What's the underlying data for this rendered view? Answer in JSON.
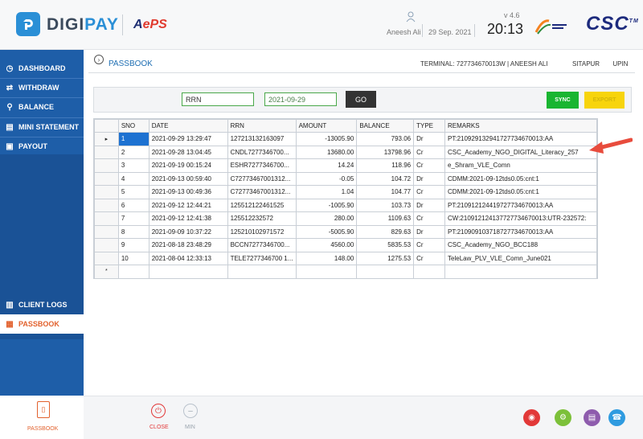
{
  "header": {
    "brand_left": "DIGI",
    "brand_right": "PAY",
    "aeps_a": "A",
    "aeps_e": "e",
    "aeps_ps": "PS",
    "user_name": "Aneesh Ali",
    "date": "29 Sep. 2021",
    "version": "v 4.6",
    "time": "20:13",
    "csc": "CSC",
    "tm": "TM"
  },
  "sidebar": {
    "items": [
      {
        "label": "DASHBOARD",
        "icon": "dashboard-icon"
      },
      {
        "label": "WITHDRAW",
        "icon": "withdraw-icon"
      },
      {
        "label": "BALANCE",
        "icon": "balance-icon"
      },
      {
        "label": "MINI STATEMENT",
        "icon": "statement-icon"
      },
      {
        "label": "PAYOUT",
        "icon": "payout-icon"
      },
      {
        "label": "CLIENT LOGS",
        "icon": "logs-icon"
      },
      {
        "label": "PASSBOOK",
        "icon": "passbook-icon"
      }
    ],
    "active": "PASSBOOK"
  },
  "main": {
    "title": "PASSBOOK",
    "terminal": "TERMINAL: 727734670013W | ANEESH ALI",
    "location": "SITAPUR",
    "state": "UPIN"
  },
  "filters": {
    "rrn_value": "RRN",
    "date_value": "2021-09-29",
    "go_label": "GO",
    "sync_label": "SYNC",
    "export_label": "EXPORT"
  },
  "table": {
    "columns": [
      "SNO",
      "DATE",
      "RRN",
      "AMOUNT",
      "BALANCE",
      "TYPE",
      "REMARKS"
    ],
    "rows": [
      [
        "1",
        "2021-09-29 13:29:47",
        "127213132163097",
        "-13005.90",
        "793.06",
        "Dr",
        "PT:210929132941727734670013:AA"
      ],
      [
        "2",
        "2021-09-28 13:04:45",
        "CNDL7277346700...",
        "13680.00",
        "13798.96",
        "Cr",
        "CSC_Academy_NGO_DIGITAL_Literacy_257"
      ],
      [
        "3",
        "2021-09-19 00:15:24",
        "ESHR7277346700...",
        "14.24",
        "118.96",
        "Cr",
        "e_Shram_VLE_Comn"
      ],
      [
        "4",
        "2021-09-13 00:59:40",
        "C72773467001312...",
        "-0.05",
        "104.72",
        "Dr",
        "CDMM:2021-09-12tds0.05:cnt:1"
      ],
      [
        "5",
        "2021-09-13 00:49:36",
        "C72773467001312...",
        "1.04",
        "104.77",
        "Cr",
        "CDMM:2021-09-12tds0.05:cnt:1"
      ],
      [
        "6",
        "2021-09-12 12:44:21",
        "125512122461525",
        "-1005.90",
        "103.73",
        "Dr",
        "PT:210912124419727734670013:AA"
      ],
      [
        "7",
        "2021-09-12 12:41:38",
        "125512232572",
        "280.00",
        "1109.63",
        "Cr",
        "CW:210912124137727734670013:UTR-232572:"
      ],
      [
        "8",
        "2021-09-09 10:37:22",
        "125210102971572",
        "-5005.90",
        "829.63",
        "Dr",
        "PT:210909103718727734670013:AA"
      ],
      [
        "9",
        "2021-08-18 23:48:29",
        "BCCN7277346700...",
        "4560.00",
        "5835.53",
        "Cr",
        "CSC_Academy_NGO_BCC188"
      ],
      [
        "10",
        "2021-08-04 12:33:13",
        "TELE7277346700 1...",
        "148.00",
        "1275.53",
        "Cr",
        "TeleLaw_PLV_VLE_Comn_June021"
      ]
    ]
  },
  "footer": {
    "passbook_label": "PASSBOOK",
    "close_label": "CLOSE",
    "min_label": "MIN"
  },
  "colors": {
    "sidebar_bg": "#1e5ea8",
    "accent_orange": "#e2612d",
    "sync_green": "#19b531",
    "export_yellow": "#f7d40c",
    "selected_row": "#1e72d1",
    "annotation_arrow": "#e84c3d"
  }
}
